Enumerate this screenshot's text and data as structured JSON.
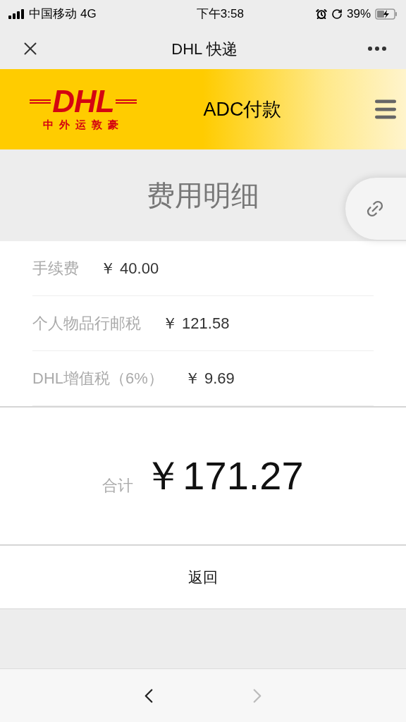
{
  "status_bar": {
    "carrier": "中国移动",
    "network": "4G",
    "time": "下午3:58",
    "battery": "39%"
  },
  "nav": {
    "title": "DHL 快递"
  },
  "header": {
    "logo_text": "DHL",
    "logo_subtext": "中外运敦豪",
    "title": "ADC付款"
  },
  "section": {
    "title": "费用明细"
  },
  "fees": [
    {
      "label": "手续费",
      "amount": "￥ 40.00"
    },
    {
      "label": "个人物品行邮税",
      "amount": "￥ 121.58"
    },
    {
      "label": "DHL增值税（6%）",
      "amount": "￥ 9.69"
    }
  ],
  "total": {
    "label": "合计",
    "amount": "￥171.27"
  },
  "back_button": "返回",
  "toolbar": {
    "back_disabled": false,
    "forward_disabled": true
  }
}
